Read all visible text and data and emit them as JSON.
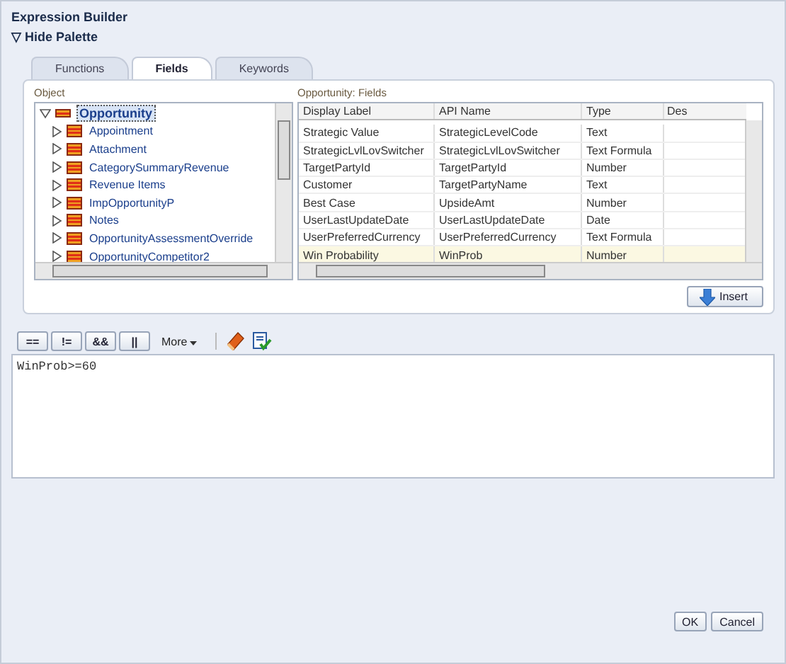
{
  "window": {
    "title": "Expression Builder"
  },
  "palette_toggle": {
    "label": "Hide Palette",
    "symbol": "▽"
  },
  "tabs": [
    {
      "label": "Functions",
      "selected": false
    },
    {
      "label": "Fields",
      "selected": true
    },
    {
      "label": "Keywords",
      "selected": false
    }
  ],
  "object_tree": {
    "label": "Object",
    "items": [
      {
        "label": "Opportunity",
        "selected": true,
        "expanded": true,
        "children": [
          {
            "label": "Appointment",
            "selected": false,
            "expanded": false
          },
          {
            "label": "Attachment",
            "selected": false,
            "expanded": false
          },
          {
            "label": "CategorySummaryRevenue",
            "selected": false,
            "expanded": false
          },
          {
            "label": "Revenue Items",
            "selected": false,
            "expanded": false
          },
          {
            "label": "ImpOpportunityP",
            "selected": false,
            "expanded": false
          },
          {
            "label": "Notes",
            "selected": false,
            "expanded": false
          },
          {
            "label": "OpportunityAssessmentOverride",
            "selected": false,
            "expanded": false
          },
          {
            "label": "OpportunityCompetitor2",
            "selected": false,
            "expanded": false
          }
        ]
      }
    ]
  },
  "fields_table": {
    "label": "Opportunity: Fields",
    "columns": [
      "Display Label",
      "API Name",
      "Type",
      "Des"
    ],
    "rows": [
      {
        "cells": [
          "Strategic Value",
          "StrategicLevelCode",
          "Text"
        ],
        "selected": false
      },
      {
        "cells": [
          "StrategicLvlLovSwitcher",
          "StrategicLvlLovSwitcher",
          "Text Formula"
        ],
        "selected": false
      },
      {
        "cells": [
          "TargetPartyId",
          "TargetPartyId",
          "Number"
        ],
        "selected": false
      },
      {
        "cells": [
          "Customer",
          "TargetPartyName",
          "Text"
        ],
        "selected": false
      },
      {
        "cells": [
          "Best Case",
          "UpsideAmt",
          "Number"
        ],
        "selected": false
      },
      {
        "cells": [
          "UserLastUpdateDate",
          "UserLastUpdateDate",
          "Date"
        ],
        "selected": false
      },
      {
        "cells": [
          "UserPreferredCurrency",
          "UserPreferredCurrency",
          "Text Formula"
        ],
        "selected": false
      },
      {
        "cells": [
          "Win Probability",
          "WinProb",
          "Number"
        ],
        "selected": true
      }
    ]
  },
  "insert_button": "Insert",
  "operators": [
    "==",
    "!=",
    "&&",
    "||"
  ],
  "more_menu": "More",
  "expression": "WinProb>=60",
  "buttons": [
    "OK",
    "Cancel"
  ]
}
